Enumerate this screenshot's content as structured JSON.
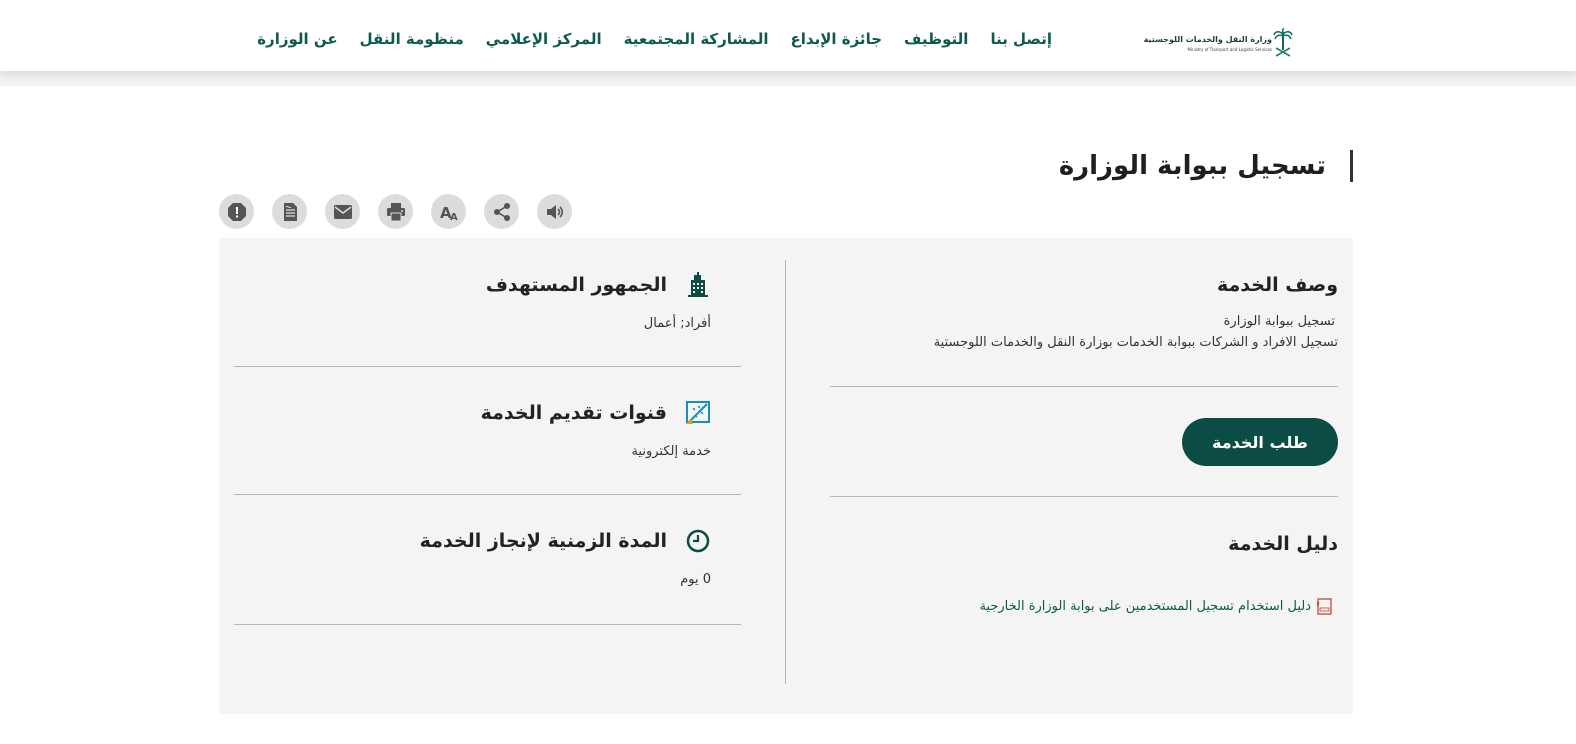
{
  "header": {
    "logo": {
      "name_ar": "وزارة النقل والخدمات اللوجستية",
      "name_en": "Ministry of Transport and Logistic Services"
    },
    "nav": [
      {
        "label": "عن الوزارة",
        "name": "nav-about"
      },
      {
        "label": "منظومة النقل",
        "name": "nav-transport-system"
      },
      {
        "label": "المركز الإعلامي",
        "name": "nav-media-center"
      },
      {
        "label": "المشاركة المجتمعية",
        "name": "nav-community"
      },
      {
        "label": "جائزة الإبداع",
        "name": "nav-creativity-award"
      },
      {
        "label": "التوظيف",
        "name": "nav-careers"
      },
      {
        "label": "إتصل بنا",
        "name": "nav-contact"
      }
    ]
  },
  "page": {
    "title": "تسجيل ببوابة الوزارة"
  },
  "toolbar": {
    "icons": [
      "report-icon",
      "document-icon",
      "email-icon",
      "print-icon",
      "font-size-icon",
      "share-icon",
      "speaker-icon"
    ]
  },
  "service": {
    "description": {
      "heading": "وصف الخدمة",
      "line1": "تسجيل ببوابة الوزارة",
      "line2": "تسجيل الافراد و الشركات ببوابة الخدمات بوزارة النقل والخدمات اللوجستية"
    },
    "request_button": "طلب الخدمة",
    "guide": {
      "heading": "دليل الخدمة",
      "link": "دليل استخدام تسجيل المستخدمين على بوابة الوزارة الخارجية"
    },
    "audience": {
      "heading": "الجمهور المستهدف",
      "value": "أفراد; أعمال"
    },
    "channels": {
      "heading": "قنوات تقديم الخدمة",
      "value": "خدمة إلكترونية"
    },
    "duration": {
      "heading": "المدة الزمنية لإنجاز الخدمة",
      "value": "0 يوم"
    }
  },
  "colors": {
    "brand": "#0b4d44",
    "link": "#0d5a4e",
    "card_bg": "#f4f4f4"
  }
}
